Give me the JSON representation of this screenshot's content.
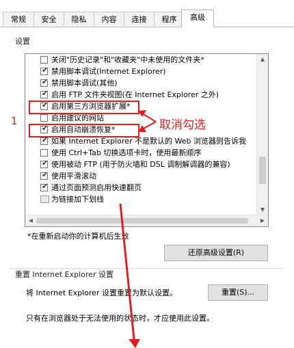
{
  "tabs": [
    {
      "label": "常规",
      "active": false
    },
    {
      "label": "安全",
      "active": false
    },
    {
      "label": "隐私",
      "active": false
    },
    {
      "label": "内容",
      "active": false
    },
    {
      "label": "连接",
      "active": false
    },
    {
      "label": "程序",
      "active": false
    },
    {
      "label": "高级",
      "active": true
    }
  ],
  "settings": {
    "group_label": "设置",
    "items": [
      {
        "label": "关闭\"历史记录\"和\"收藏夹\"中未使用的文件夹*",
        "checked": false
      },
      {
        "label": "禁用脚本调试(Internet Explorer)",
        "checked": true
      },
      {
        "label": "禁用脚本调试(其他)",
        "checked": true
      },
      {
        "label": "启用 FTP 文件夹视图(在 Internet Explorer 之外)",
        "checked": true
      },
      {
        "label": "启用第三方浏览器扩展*",
        "checked": true
      },
      {
        "label": "启用建议的网站",
        "checked": false
      },
      {
        "label": "启用自动崩溃恢复*",
        "checked": true
      },
      {
        "label": "如果 Internet Explorer 不是默认的 Web 浏览器则告诉我",
        "checked": true
      },
      {
        "label": "使用 Ctrl+Tab 切换选项卡时，使用最新顺序",
        "checked": false
      },
      {
        "label": "使用被动 FTP (用于防火墙和 DSL 调制解调器的兼容)",
        "checked": true
      },
      {
        "label": "使用平滑滚动",
        "checked": true
      },
      {
        "label": "通过页面预测启用快速翻页",
        "checked": true
      },
      {
        "label": "为链接加下划线",
        "checked": null
      }
    ],
    "restart_note": "*在重新启动你的计算机后生效",
    "restore_button": "还原高级设置(R)"
  },
  "reset": {
    "group_label": "重置 Internet Explorer 设置",
    "description": "将 Internet Explorer 设置重置为默认设置。",
    "reset_button": "重置(S)...",
    "note": "只有在浏览器处于无法使用的状态时，才应使用此设置。"
  },
  "annotation": {
    "number": "1",
    "text": "取消勾选"
  },
  "colors": {
    "annotation_red": "#e02020",
    "check_mark": "#333333"
  }
}
